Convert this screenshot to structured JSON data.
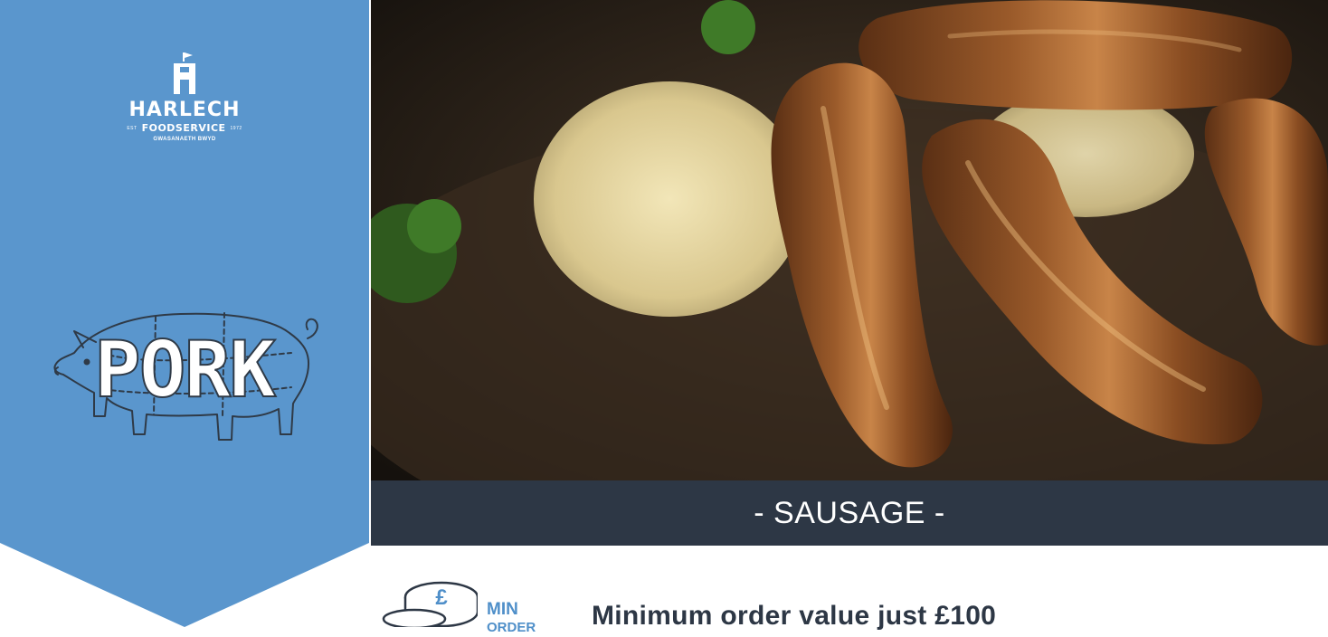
{
  "brand": {
    "name": "HARLECH",
    "est": "EST",
    "division": "FOODSERVICE",
    "year": "1972",
    "welsh": "GWASANAETH BWYD"
  },
  "category": "PORK",
  "product_heading": "- SAUSAGE -",
  "min_order": {
    "badge_line1": "MIN",
    "badge_line2": "ORDER",
    "text": "Minimum order value just £100"
  },
  "colors": {
    "banner_blue": "#5a96cd",
    "caption_bar": "#2d3745",
    "accent_blue": "#4f8fc9"
  },
  "icons": [
    "castle-logo-icon",
    "pig-outline-icon",
    "coin-stack-icon"
  ]
}
